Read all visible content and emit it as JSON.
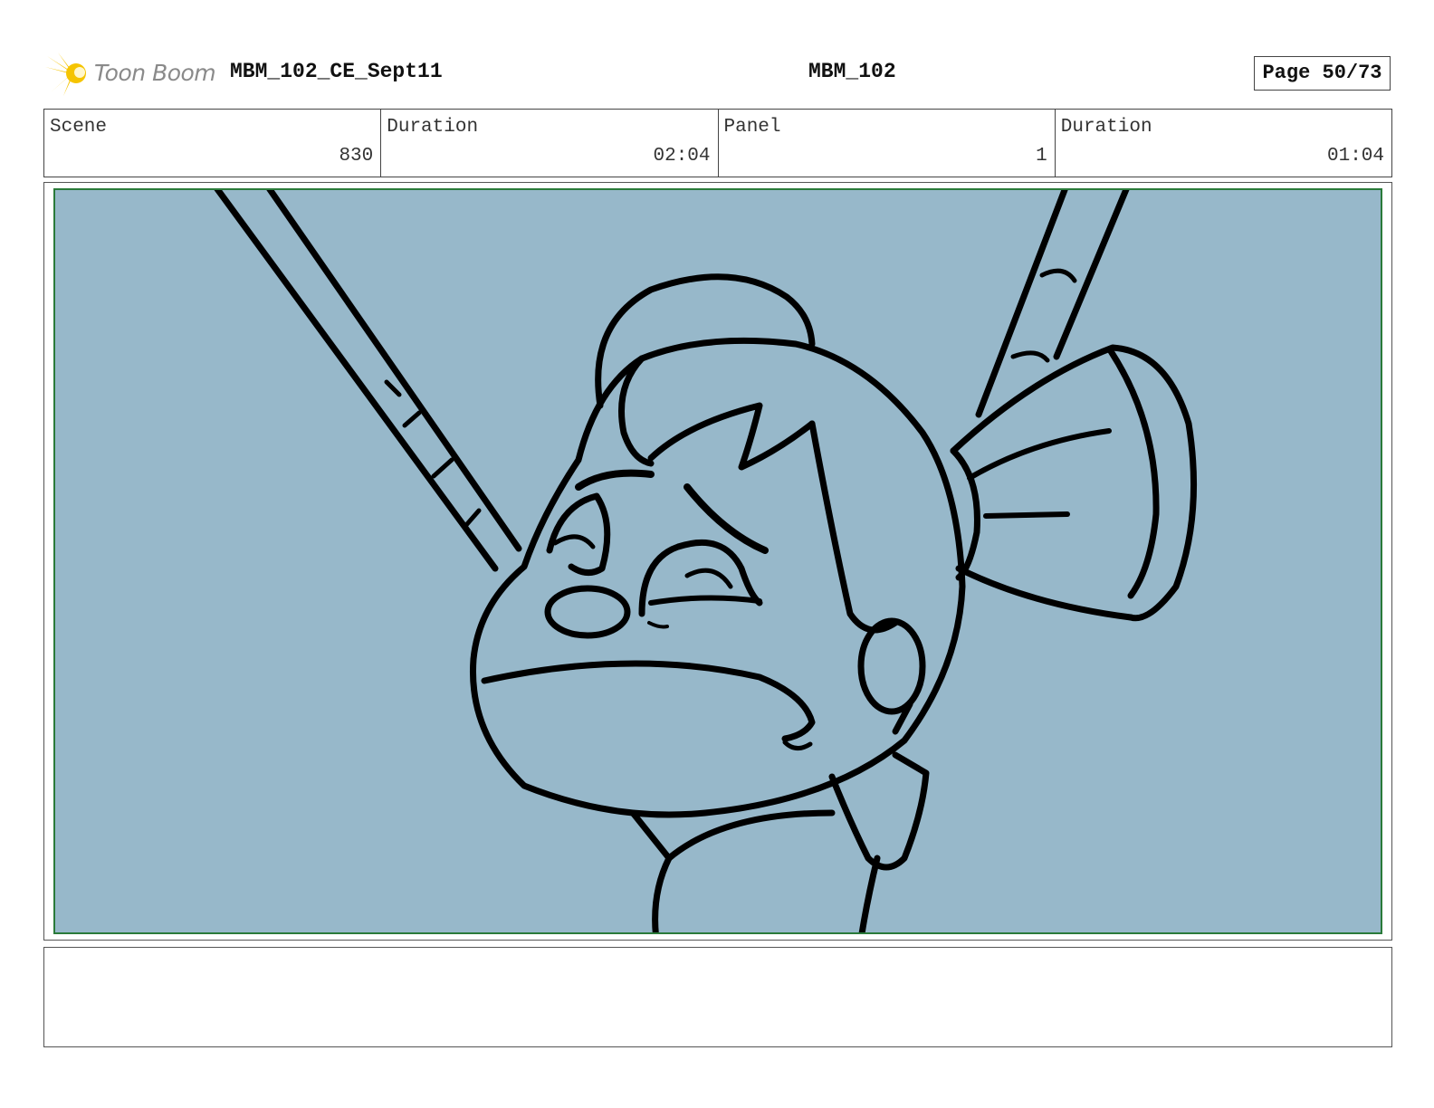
{
  "header": {
    "logo_text": "Toon Boom",
    "logo_color": "#f5c400",
    "project": "MBM_102_CE_Sept11",
    "episode": "MBM_102",
    "page_label": "Page 50/73"
  },
  "info": {
    "scene_label": "Scene",
    "scene_value": "830",
    "scene_duration_label": "Duration",
    "scene_duration_value": "02:04",
    "panel_label": "Panel",
    "panel_value": "1",
    "panel_duration_label": "Duration",
    "panel_duration_value": "01:04"
  },
  "panel": {
    "background_color": "#97b8ca",
    "safe_frame_color": "#2a7a3a"
  },
  "notes": {
    "text": ""
  }
}
